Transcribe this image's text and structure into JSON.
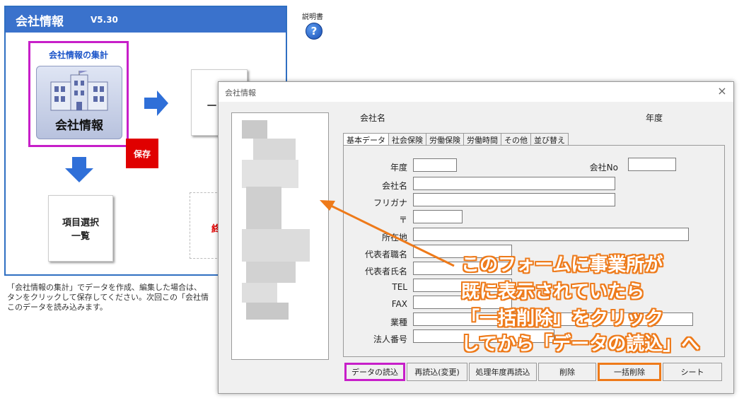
{
  "app": {
    "title": "会社情報",
    "version": "V5.30"
  },
  "main": {
    "aggregate_label": "会社情報の集計",
    "company_button_label": "会社情報",
    "save_label": "保存",
    "list_card_line1": "項目選択",
    "list_card_line2": "一覧",
    "right_card1_partial": "一",
    "right_card2_partial": "終",
    "description_lines": [
      "「会社情報の集計」でデータを作成、編集した場合は、",
      "タンをクリックして保存してください。次回この「会社情",
      "このデータを読み込みます。"
    ]
  },
  "help": {
    "label": "説明書",
    "icon_glyph": "?"
  },
  "dialog": {
    "title": "会社情報",
    "close_glyph": "×",
    "company_name_label": "会社名",
    "year_label": "年度",
    "tabs": [
      "基本データ",
      "社会保険",
      "労働保険",
      "労働時間",
      "その他",
      "並び替え"
    ],
    "fields": {
      "year": "年度",
      "company_no": "会社No",
      "company_name": "会社名",
      "furigana": "フリガナ",
      "postal": "〒",
      "address": "所在地",
      "rep_title": "代表者職名",
      "rep_name": "代表者氏名",
      "tel": "TEL",
      "fax": "FAX",
      "industry": "業種",
      "corp_no": "法人番号"
    },
    "buttons": [
      "データの読込",
      "再読込(変更)",
      "処理年度再読込",
      "削除",
      "一括削除",
      "シート"
    ]
  },
  "annotation": {
    "lines": [
      "このフォームに事業所が",
      "既に表示されていたら",
      "「一括削除」をクリック",
      "してから「データの読込」へ"
    ],
    "accent_color": "#ee7a1a",
    "highlight_color": "#c71fc9"
  }
}
